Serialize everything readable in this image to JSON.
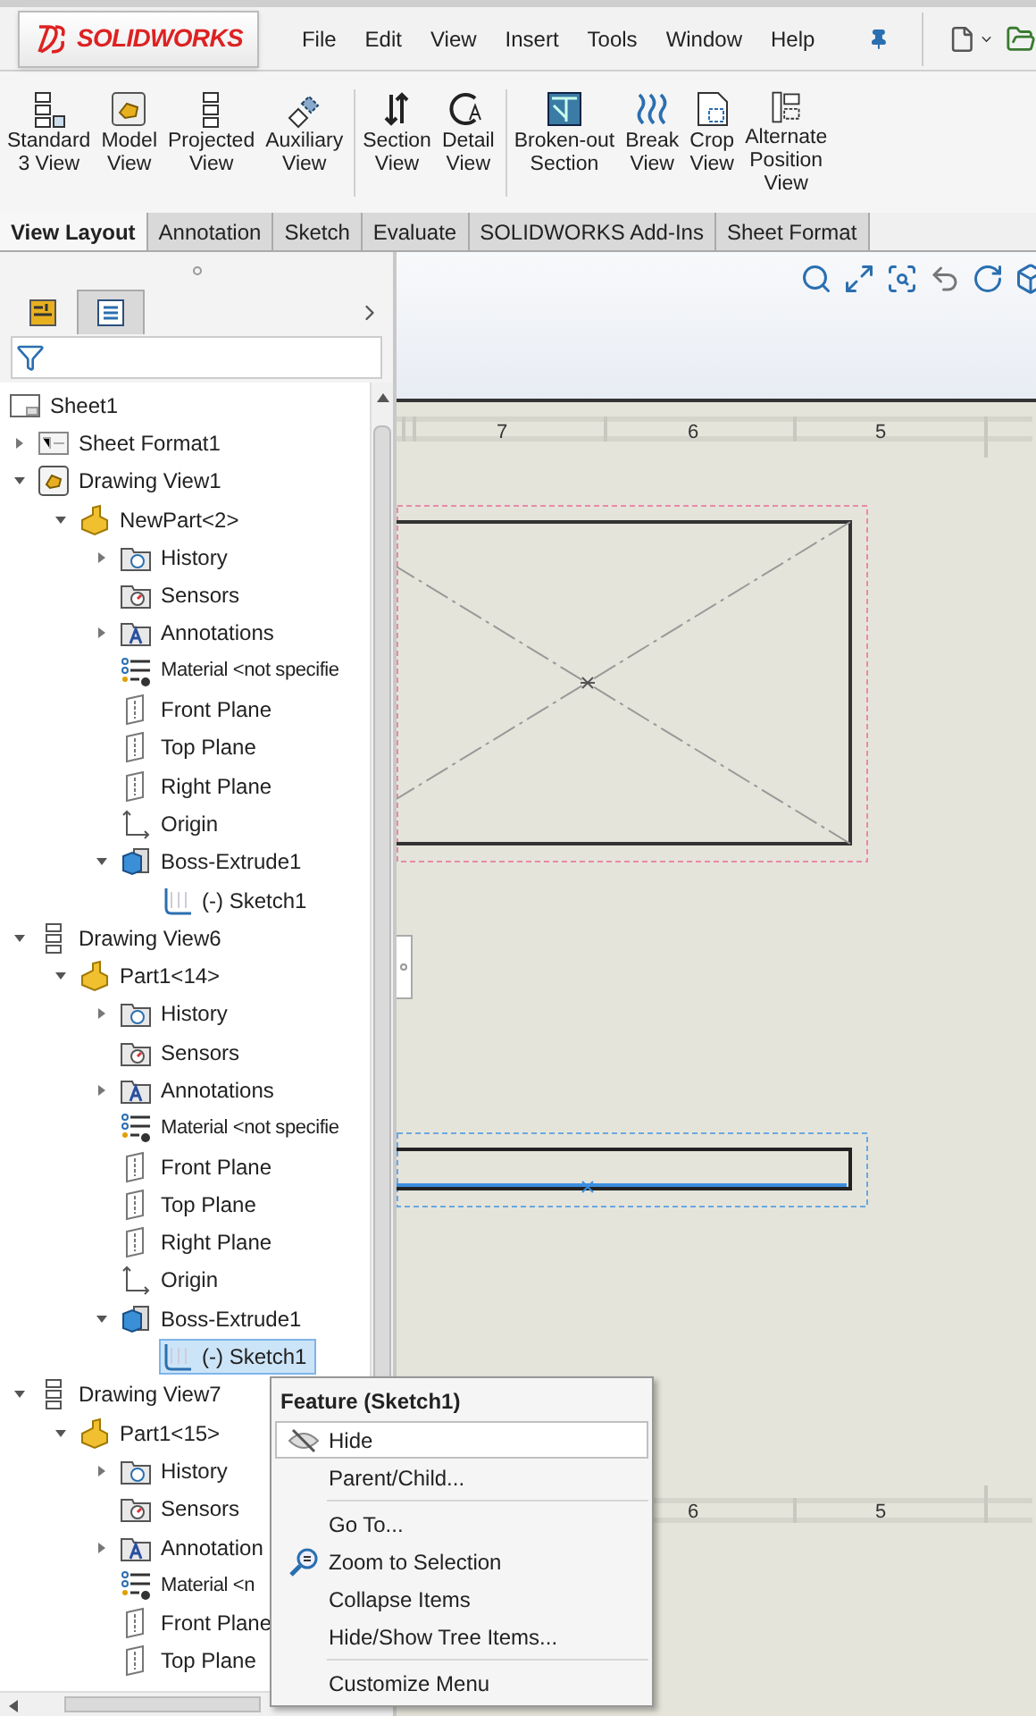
{
  "app": {
    "logo": "SOLIDWORKS"
  },
  "menu_bar": [
    "File",
    "Edit",
    "View",
    "Insert",
    "Tools",
    "Window",
    "Help"
  ],
  "ribbon": {
    "groups": [
      [
        {
          "kind": "standard",
          "lines": [
            "Standard",
            "3 View"
          ]
        },
        {
          "kind": "model",
          "lines": [
            "Model",
            "View"
          ]
        },
        {
          "kind": "projected",
          "lines": [
            "Projected",
            "View"
          ]
        },
        {
          "kind": "auxiliary",
          "lines": [
            "Auxiliary",
            "View"
          ]
        }
      ],
      [
        {
          "kind": "section",
          "lines": [
            "Section",
            "View"
          ]
        },
        {
          "kind": "detail",
          "lines": [
            "Detail",
            "View"
          ]
        }
      ],
      [
        {
          "kind": "broken",
          "lines": [
            "Broken-out",
            "Section"
          ]
        },
        {
          "kind": "break",
          "lines": [
            "Break",
            "View"
          ]
        },
        {
          "kind": "crop",
          "lines": [
            "Crop",
            "View"
          ]
        },
        {
          "kind": "alternate",
          "lines": [
            "Alternate",
            "Position",
            "View"
          ]
        }
      ]
    ]
  },
  "tabs": [
    {
      "label": "View Layout",
      "selected": true
    },
    {
      "label": "Annotation",
      "selected": false
    },
    {
      "label": "Sketch",
      "selected": false
    },
    {
      "label": "Evaluate",
      "selected": false
    },
    {
      "label": "SOLIDWORKS Add-Ins",
      "selected": false
    },
    {
      "label": "Sheet Format",
      "selected": false
    }
  ],
  "panel_tabs": [
    {
      "kind": "property",
      "selected": false
    },
    {
      "kind": "tree",
      "selected": true
    }
  ],
  "tree": [
    {
      "label": "Sheet1",
      "kind": "sheet",
      "selected": false,
      "children": [
        {
          "label": "Sheet Format1",
          "kind": "sheet-format",
          "selected": false,
          "expanded": false
        },
        {
          "label": "Drawing View1",
          "kind": "model-view",
          "selected": false,
          "expanded": true,
          "children": [
            {
              "label": "NewPart<2>",
              "kind": "part",
              "selected": false,
              "expanded": true,
              "children": [
                {
                  "label": "History",
                  "kind": "history",
                  "selected": false,
                  "expanded": false
                },
                {
                  "label": "Sensors",
                  "kind": "sensors",
                  "selected": false
                },
                {
                  "label": "Annotations",
                  "kind": "annotations",
                  "selected": false,
                  "expanded": false
                },
                {
                  "label": "Material <not specifie",
                  "kind": "material",
                  "selected": false
                },
                {
                  "label": "Front Plane",
                  "kind": "plane",
                  "selected": false
                },
                {
                  "label": "Top Plane",
                  "kind": "plane",
                  "selected": false
                },
                {
                  "label": "Right Plane",
                  "kind": "plane",
                  "selected": false
                },
                {
                  "label": "Origin",
                  "kind": "origin",
                  "selected": false
                },
                {
                  "label": "Boss-Extrude1",
                  "kind": "extrude",
                  "selected": false,
                  "expanded": true,
                  "children": [
                    {
                      "label": "(-) Sketch1",
                      "kind": "sketch",
                      "selected": false
                    }
                  ]
                }
              ]
            }
          ]
        },
        {
          "label": "Drawing View6",
          "kind": "projected-view",
          "selected": false,
          "expanded": true,
          "children": [
            {
              "label": "Part1<14>",
              "kind": "part",
              "selected": false,
              "expanded": true,
              "children": [
                {
                  "label": "History",
                  "kind": "history",
                  "selected": false,
                  "expanded": false
                },
                {
                  "label": "Sensors",
                  "kind": "sensors",
                  "selected": false
                },
                {
                  "label": "Annotations",
                  "kind": "annotations",
                  "selected": false,
                  "expanded": false
                },
                {
                  "label": "Material <not specifie",
                  "kind": "material",
                  "selected": false
                },
                {
                  "label": "Front Plane",
                  "kind": "plane",
                  "selected": false
                },
                {
                  "label": "Top Plane",
                  "kind": "plane",
                  "selected": false
                },
                {
                  "label": "Right Plane",
                  "kind": "plane",
                  "selected": false
                },
                {
                  "label": "Origin",
                  "kind": "origin",
                  "selected": false
                },
                {
                  "label": "Boss-Extrude1",
                  "kind": "extrude",
                  "selected": false,
                  "expanded": true,
                  "children": [
                    {
                      "label": "(-) Sketch1",
                      "kind": "sketch",
                      "selected": true
                    }
                  ]
                }
              ]
            }
          ]
        },
        {
          "label": "Drawing View7",
          "kind": "projected-view",
          "selected": false,
          "expanded": true,
          "children": [
            {
              "label": "Part1<15>",
              "kind": "part",
              "selected": false,
              "expanded": true,
              "children": [
                {
                  "label": "History",
                  "kind": "history",
                  "selected": false,
                  "expanded": false
                },
                {
                  "label": "Sensors",
                  "kind": "sensors",
                  "selected": false
                },
                {
                  "label": "Annotation",
                  "kind": "annotations",
                  "selected": false,
                  "expanded": false
                },
                {
                  "label": "Material <n",
                  "kind": "material",
                  "selected": false
                },
                {
                  "label": "Front Plane",
                  "kind": "plane",
                  "selected": false
                },
                {
                  "label": "Top Plane",
                  "kind": "plane",
                  "selected": false
                }
              ]
            }
          ]
        }
      ]
    }
  ],
  "canvas": {
    "top_ruler": [
      "7",
      "6",
      "5"
    ],
    "bottom_ruler": [
      "6",
      "5"
    ]
  },
  "context_menu": {
    "title": "Feature (Sketch1)",
    "groups": [
      [
        {
          "label": "Hide",
          "kind": "hide",
          "selected": true
        },
        {
          "label": "Parent/Child...",
          "kind": "plain",
          "selected": false
        }
      ],
      [
        {
          "label": "Go To...",
          "kind": "plain",
          "selected": false
        },
        {
          "label": "Zoom to Selection",
          "kind": "zoom",
          "selected": false
        },
        {
          "label": "Collapse Items",
          "kind": "plain",
          "selected": false
        },
        {
          "label": "Hide/Show Tree Items...",
          "kind": "plain",
          "selected": false
        }
      ],
      [
        {
          "label": "Customize Menu",
          "kind": "plain",
          "selected": false
        }
      ]
    ]
  }
}
